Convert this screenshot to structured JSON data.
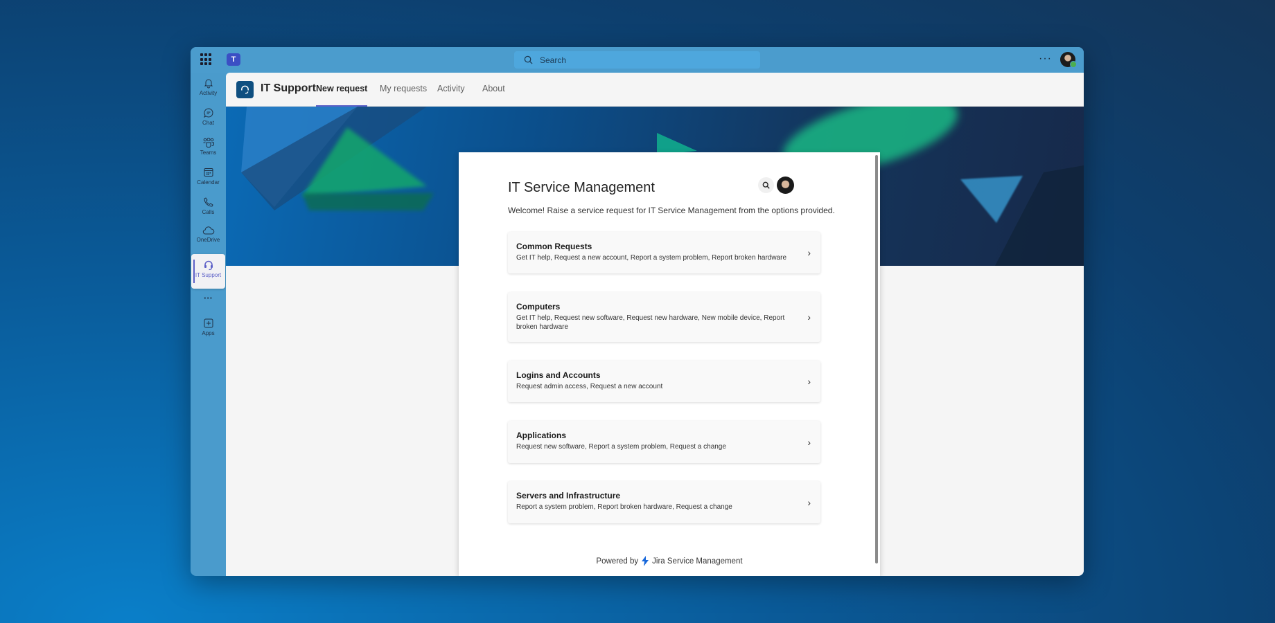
{
  "titlebar": {
    "search_placeholder": "Search",
    "more": "···"
  },
  "rail": {
    "items": [
      {
        "label": "Activity",
        "icon": "bell-icon"
      },
      {
        "label": "Chat",
        "icon": "chat-icon"
      },
      {
        "label": "Teams",
        "icon": "teams-icon"
      },
      {
        "label": "Calendar",
        "icon": "calendar-icon"
      },
      {
        "label": "Calls",
        "icon": "phone-icon"
      },
      {
        "label": "OneDrive",
        "icon": "cloud-icon"
      },
      {
        "label": "IT Support",
        "icon": "headset-icon"
      },
      {
        "label": "···",
        "icon": "more-icon"
      },
      {
        "label": "Apps",
        "icon": "plus-icon"
      }
    ]
  },
  "app": {
    "name": "IT Support",
    "tabs": [
      "New request",
      "My requests",
      "Activity",
      "About"
    ],
    "active_tab": "New request"
  },
  "portal": {
    "title": "IT Service Management",
    "welcome": "Welcome! Raise a service request for IT Service Management from the options provided.",
    "items": [
      {
        "title": "Common Requests",
        "desc": "Get IT help, Request a new account, Report a system problem, Report broken hardware"
      },
      {
        "title": "Computers",
        "desc": "Get IT help, Request new software, Request new hardware, New mobile device, Report broken hardware"
      },
      {
        "title": "Logins and Accounts",
        "desc": "Request admin access, Request a new account"
      },
      {
        "title": "Applications",
        "desc": "Request new software, Report a system problem, Request a change"
      },
      {
        "title": "Servers and Infrastructure",
        "desc": "Report a system problem, Report broken hardware, Request a change"
      }
    ],
    "footer_prefix": "Powered by",
    "footer_brand": "Jira Service Management"
  },
  "colors": {
    "accent": "#5b5fc7",
    "jira": "#1868db"
  }
}
